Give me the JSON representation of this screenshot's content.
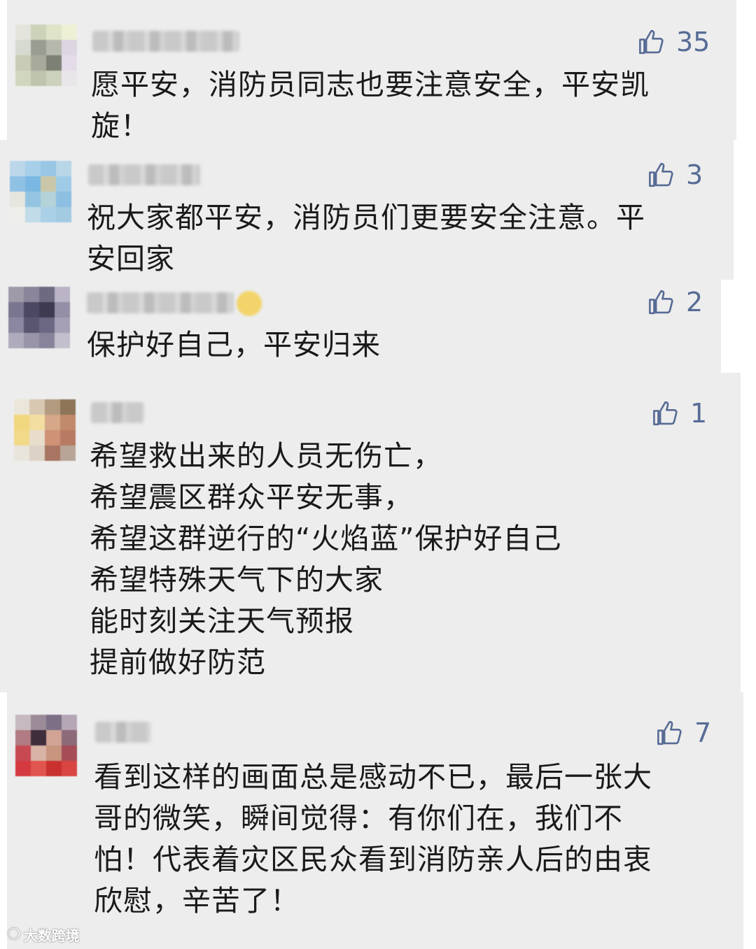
{
  "comments": [
    {
      "likes": "35",
      "text": "愿平安，消防员同志也要注意安全，平安凯\n旋！"
    },
    {
      "likes": "3",
      "text": "祝大家都平安，消防员们更要安全注意。平\n安回家"
    },
    {
      "likes": "2",
      "text": "保护好自己，平安归来"
    },
    {
      "likes": "1",
      "text": "希望救出来的人员无伤亡，\n希望震区群众平安无事，\n希望这群逆行的“火焰蓝”保护好自己\n希望特殊天气下的大家\n能时刻关注天气预报\n提前做好防范"
    },
    {
      "likes": "7",
      "text": "看到这样的画面总是感动不已，最后一张大\n哥的微笑，瞬间觉得：有你们在，我们不\n怕！代表着灾区民众看到消防亲人后的由衷\n欣慰，辛苦了！"
    }
  ],
  "icons": {
    "like": "thumbs-up-icon",
    "avatar": "blurred-avatar"
  },
  "watermark": {
    "text": "大数跨境",
    "icon": "wechat-logo-icon"
  },
  "colors": {
    "background": "#ededed",
    "like": "#576b95",
    "text": "#1a1a1a"
  }
}
